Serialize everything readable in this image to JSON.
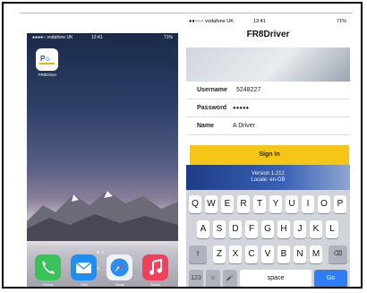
{
  "left_phone": {
    "status": {
      "carrier": "●●●●○ vodafone UK",
      "time": "13:41",
      "battery": "71%"
    },
    "app_icon": {
      "label": "FR8Driver"
    },
    "dock": [
      {
        "icon": "phone-icon",
        "label": "Phone"
      },
      {
        "icon": "mail-icon",
        "label": "Mail"
      },
      {
        "icon": "safari-icon",
        "label": "Safari"
      },
      {
        "icon": "music-icon",
        "label": "Music"
      }
    ]
  },
  "right_phone": {
    "status": {
      "carrier": "●●○○○ vodafone UK",
      "wifi": "wifi-icon",
      "time": "13:41",
      "battery": "71%"
    },
    "title": "FR8Driver",
    "form": {
      "username_label": "Username",
      "username_value": "5248227",
      "password_label": "Password",
      "password_value": "●●●●●",
      "name_label": "Name",
      "name_value": "A Driver"
    },
    "sign_in_label": "Sign In",
    "version_text": "Version 1.212",
    "locale_text": "Locale: en-GB",
    "keyboard": {
      "row1": [
        "Q",
        "W",
        "E",
        "R",
        "T",
        "Y",
        "U",
        "I",
        "O",
        "P"
      ],
      "row2": [
        "A",
        "S",
        "D",
        "F",
        "G",
        "H",
        "J",
        "K",
        "L"
      ],
      "row3": [
        "Z",
        "X",
        "C",
        "V",
        "B",
        "N",
        "M"
      ],
      "shift_symbol": "⇧",
      "delete_symbol": "⌫",
      "numbers_label": "123",
      "emoji_symbol": "☺",
      "mic_symbol": "🎤",
      "space_label": "space",
      "go_label": "Go"
    }
  }
}
